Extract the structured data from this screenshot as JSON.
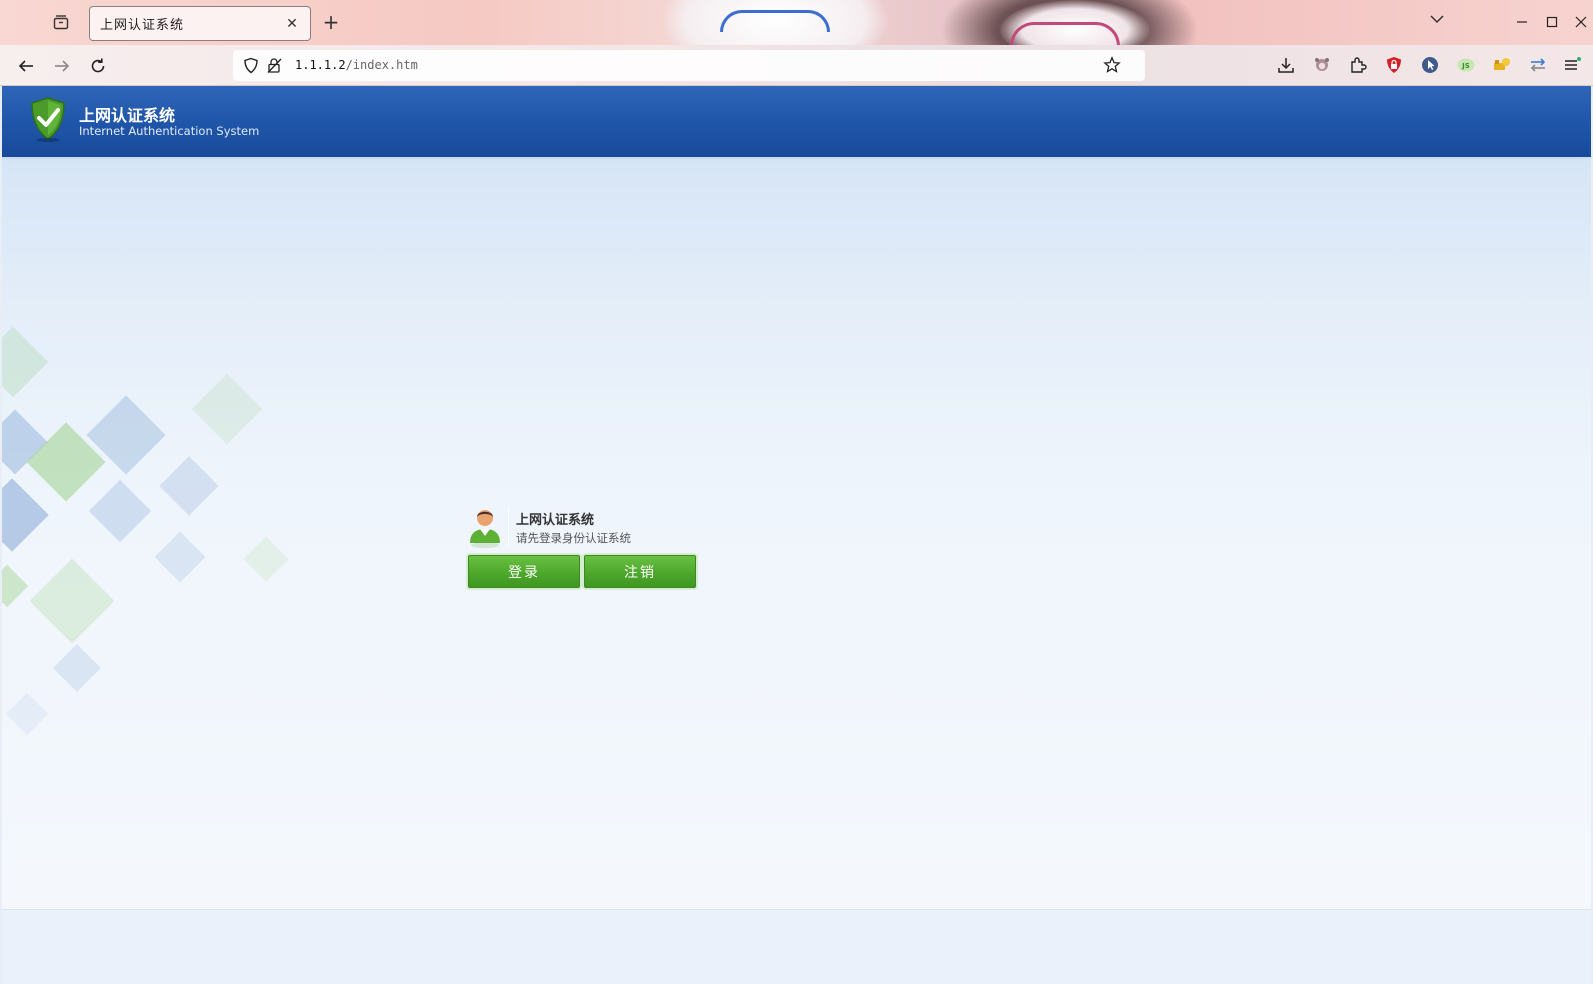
{
  "browser": {
    "tab_title": "上网认证系统",
    "url_host": "1.1.1.2",
    "url_path": "/index.htm"
  },
  "header": {
    "title": "上网认证系统",
    "subtitle": "Internet Authentication System"
  },
  "login": {
    "title": "上网认证系统",
    "subtitle": "请先登录身份认证系统",
    "login_label": "登录",
    "logout_label": "注销"
  },
  "colors": {
    "header_blue": "#1f55a8",
    "button_green": "#4ea82c"
  }
}
